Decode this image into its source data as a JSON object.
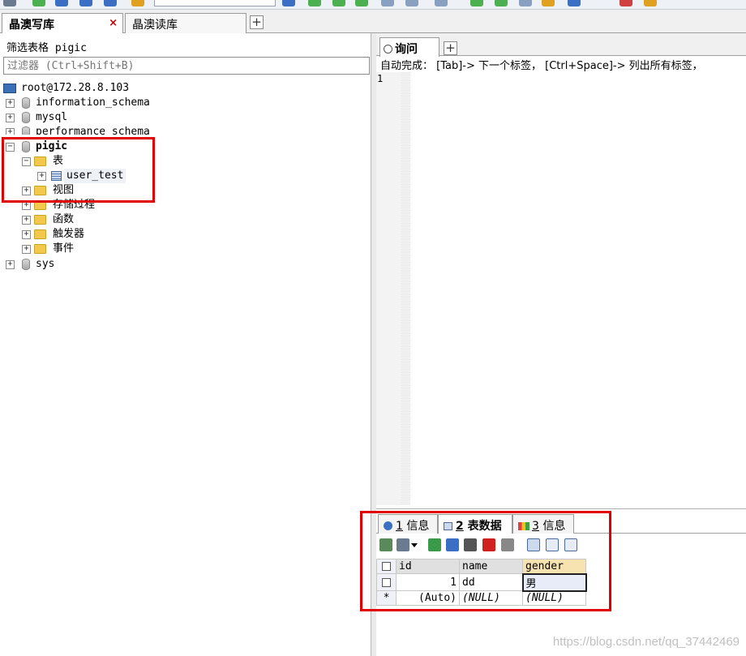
{
  "connection_tabs": [
    {
      "label": "晶澳写库",
      "close": "×"
    },
    {
      "label": "晶澳读库"
    }
  ],
  "filter": {
    "label": "筛选表格 pigic",
    "placeholder": "过滤器 (Ctrl+Shift+B)"
  },
  "toolbar_db": "pigic",
  "tree": {
    "server": "root@172.28.8.103",
    "databases": [
      "information_schema",
      "mysql",
      "performance_schema",
      "pigic",
      "sys"
    ],
    "pigic_children": {
      "tables_folder": "表",
      "table": "user_test",
      "views": "视图",
      "procedures": "存储过程",
      "functions": "函数",
      "triggers": "触发器",
      "events": "事件"
    },
    "expand_plus": "+",
    "expand_minus": "−"
  },
  "query": {
    "tab_label": "询问",
    "hint": "自动完成： [Tab]-> 下一个标签， [Ctrl+Space]-> 列出所有标签，",
    "line_number": "1"
  },
  "results": {
    "tabs": [
      {
        "num": "1",
        "label": "信息"
      },
      {
        "num": "2",
        "label": "表数据"
      },
      {
        "num": "3",
        "label": "信息"
      }
    ],
    "columns": [
      "id",
      "name",
      "gender"
    ],
    "rows": [
      {
        "marker": "",
        "id": "1",
        "name": "dd",
        "gender": "男"
      },
      {
        "marker": "*",
        "id": "(Auto)",
        "name": "(NULL)",
        "gender": "(NULL)"
      }
    ]
  },
  "watermark": "https://blog.csdn.net/qq_37442469",
  "colors": {
    "highlight_box": "#e00000",
    "accent": "#3b6fb6"
  }
}
